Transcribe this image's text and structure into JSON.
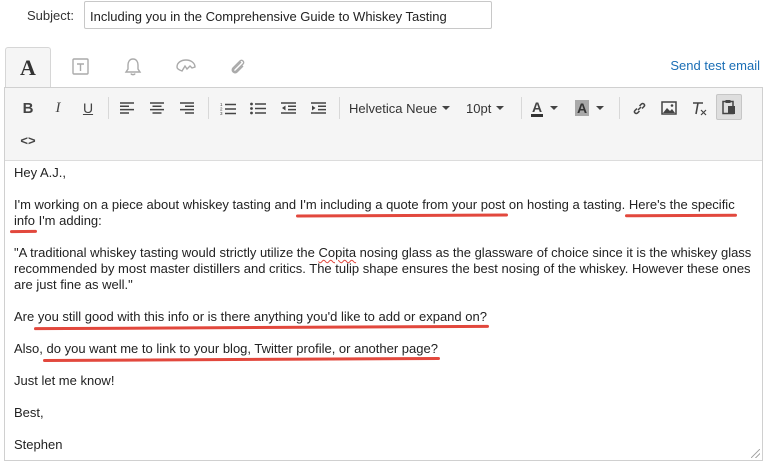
{
  "subject": {
    "label": "Subject:",
    "value": "Including you in the Comprehensive Guide to Whiskey Tasting"
  },
  "tabs": [
    {
      "icon": "text-format-icon",
      "label": "A",
      "active": true
    },
    {
      "icon": "template-icon",
      "active": false
    },
    {
      "icon": "bell-icon",
      "active": false
    },
    {
      "icon": "personalize-icon",
      "active": false
    },
    {
      "icon": "paperclip-icon",
      "active": false
    }
  ],
  "send_test_label": "Send test email",
  "toolbar": {
    "bold": "B",
    "italic": "I",
    "underline": "U",
    "font_family": "Helvetica Neue",
    "font_size": "10pt",
    "text_color_label": "A",
    "highlight_label": "A",
    "source_label": "<>"
  },
  "body": {
    "greeting": "Hey A.J.,",
    "p1_a": "I'm working on a piece about whiskey tasting and ",
    "p1_b": "I'm including a quote from your post",
    "p1_c": " on hosting a tasting. ",
    "p1_d": "Here's the specific",
    "p1_e": "info",
    "p1_f": " I'm adding:",
    "quote_a": "\"A traditional whiskey tasting would strictly utilize the ",
    "quote_spell": "Copita",
    "quote_b": " nosing glass as the glassware of choice since it is the whiskey glass recommended by most master distillers and critics. The tulip shape ensures the best nosing of the whiskey. However these ones are just fine as well.\"",
    "p3_a": "Are ",
    "p3_b": "you still good with this info or is there anything you'd like to add or expand on?",
    "p4_a": "Also, ",
    "p4_b": "do you want me to link to your blog, Twitter profile, or another page?",
    "p5": "Just let me know!",
    "signoff": "Best,",
    "name": "Stephen"
  },
  "colors": {
    "link": "#1a6eb5",
    "annotation": "#e2483d",
    "toolbar_bg": "#f5f5f5"
  }
}
